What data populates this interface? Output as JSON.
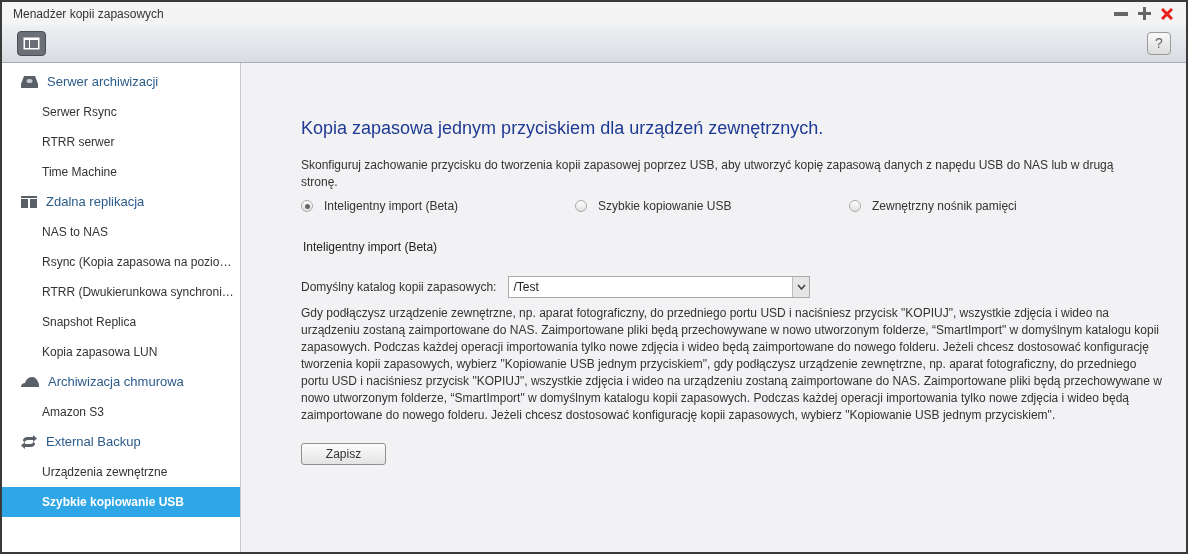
{
  "window": {
    "title": "Menadżer kopii zapasowych"
  },
  "sidebar": {
    "groups": [
      {
        "label": "Serwer archiwizacji",
        "items": [
          {
            "label": "Serwer Rsync",
            "selected": false
          },
          {
            "label": "RTRR serwer",
            "selected": false
          },
          {
            "label": "Time Machine",
            "selected": false
          }
        ]
      },
      {
        "label": "Zdalna replikacja",
        "items": [
          {
            "label": "NAS to NAS",
            "selected": false
          },
          {
            "label": "Rsync (Kopia zapasowa na pozio…",
            "selected": false
          },
          {
            "label": "RTRR (Dwukierunkowa synchroni…",
            "selected": false
          },
          {
            "label": "Snapshot Replica",
            "selected": false
          },
          {
            "label": "Kopia zapasowa LUN",
            "selected": false
          }
        ]
      },
      {
        "label": "Archiwizacja chmurowa",
        "items": [
          {
            "label": "Amazon S3",
            "selected": false
          }
        ]
      },
      {
        "label": "External Backup",
        "items": [
          {
            "label": "Urządzenia zewnętrzne",
            "selected": false
          },
          {
            "label": "Szybkie kopiowanie USB",
            "selected": true
          }
        ]
      }
    ]
  },
  "main": {
    "heading": "Kopia zapasowa jednym przyciskiem dla urządzeń zewnętrznych.",
    "intro": "Skonfiguruj zachowanie przycisku do tworzenia kopii zapasowej poprzez USB, aby utworzyć kopię zapasową danych z napędu USB do NAS lub w drugą stronę.",
    "options": [
      {
        "label": "Inteligentny import (Beta)",
        "selected": true
      },
      {
        "label": "Szybkie kopiowanie USB",
        "selected": false
      },
      {
        "label": "Zewnętrzny nośnik pamięci",
        "selected": false
      }
    ],
    "section_title": "Inteligentny import (Beta)",
    "folder": {
      "label": "Domyślny katalog kopii zapasowych:",
      "value": "/Test"
    },
    "description": "Gdy podłączysz urządzenie zewnętrzne, np. aparat fotograficzny, do przedniego portu USD i naciśniesz przycisk \"KOPIUJ\", wszystkie zdjęcia i wideo na urządzeniu zostaną zaimportowane do NAS. Zaimportowane pliki będą przechowywane w nowo utworzonym folderze, “SmartImport\" w domyślnym katalogu kopii zapasowych. Podczas każdej operacji importowania tylko nowe zdjęcia i wideo będą zaimportowane do nowego folderu. Jeżeli chcesz dostosować konfigurację tworzenia kopii zapasowych, wybierz \"Kopiowanie USB jednym przyciskiem\", gdy podłączysz urządzenie zewnętrzne, np. aparat fotograficzny, do przedniego portu USD i naciśniesz przycisk \"KOPIUJ\", wszystkie zdjęcia i wideo na urządzeniu zostaną zaimportowane do NAS. Zaimportowane pliki będą przechowywane w nowo utworzonym folderze, “SmartImport\" w domyślnym katalogu kopii zapasowych. Podczas każdej operacji importowania tylko nowe zdjęcia i wideo będą zaimportowane do nowego folderu. Jeżeli chcesz dostosować konfigurację kopii zapasowych, wybierz \"Kopiowanie USB jednym przyciskiem\".",
    "save_button": "Zapisz"
  },
  "help_button": "?"
}
